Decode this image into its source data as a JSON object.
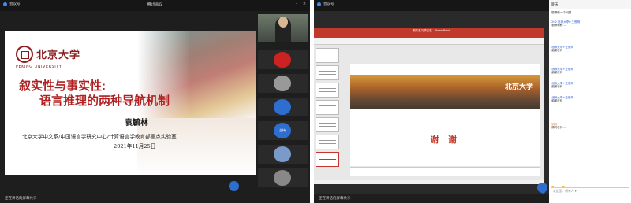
{
  "left": {
    "window_title": "腾讯会议",
    "meeting_id": "会议号",
    "slide": {
      "university_cn": "北京大学",
      "university_en": "PEKING UNIVERSITY",
      "title_line1": "叙实性与事实性:",
      "title_line2": "语言推理的两种导航机制",
      "author": "袁毓林",
      "affiliation": "北京大学中文系/中国语言学研究中心/计算语言学教育部重点实验室",
      "date": "2021年11月25日"
    },
    "speaker_tag": "正在讲话的屏幕共享",
    "float_button": "",
    "thumbnails": [
      "",
      "",
      "",
      "",
      "",
      "",
      ""
    ],
    "thumb_circle_label": "主持"
  },
  "right": {
    "meeting_id": "会议号",
    "ppt_title": "叙实性与事实性 - PowerPoint",
    "slide": {
      "university": "北京大学",
      "thanks": "谢 谢"
    },
    "speaker_tag": "正在讲话的屏幕共享",
    "chat": {
      "header": "聊天",
      "messages": [
        {
          "text": "想请教一个问题…"
        },
        {
          "who": "202 北师大李+王惟明",
          "text": "老师请教…"
        },
        {
          "who": "北师大李+王惟明",
          "text": "谢谢老师"
        },
        {
          "who": "北师大李+王惟明",
          "text": "谢谢老师"
        },
        {
          "who": "北师大李+王惟明",
          "text": "谢谢老师"
        },
        {
          "who": "北师大李+王惟明",
          "text": "谢谢老师"
        },
        {
          "who": "字音",
          "text": "请问老师…"
        }
      ],
      "input_placeholder": "发送至：所有人 ▾"
    }
  }
}
